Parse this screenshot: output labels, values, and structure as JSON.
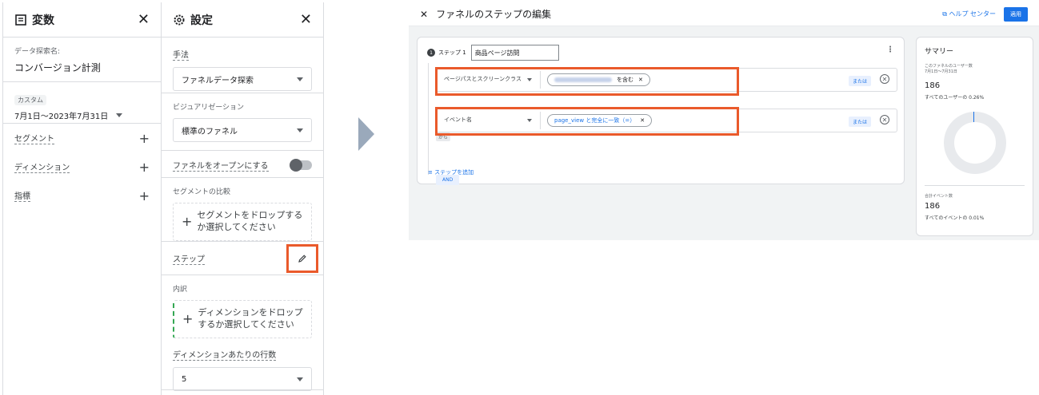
{
  "variables": {
    "title": "変数",
    "explore_name_label": "データ探索名:",
    "explore_name": "コンバージョン計測",
    "date_badge": "カスタム",
    "date_range": "7月1日～2023年7月31日",
    "rows": [
      "セグメント",
      "ディメンション",
      "指標"
    ]
  },
  "settings": {
    "title": "設定",
    "method_label": "手法",
    "method_value": "ファネルデータ探索",
    "viz_label": "ビジュアリゼーション",
    "viz_value": "標準のファネル",
    "open_funnel_label": "ファネルをオープンにする",
    "segment_compare_label": "セグメントの比較",
    "segment_drop": "セグメントをドロップするか選択してください",
    "steps_label": "ステップ",
    "breakdown_label": "内訳",
    "dimension_drop": "ディメンションをドロップするか選択してください",
    "rows_per_dim_label": "ディメンションあたりの行数",
    "rows_per_dim_value": "5"
  },
  "editor": {
    "title": "ファネルのステップの編集",
    "help": "ヘルプ センター",
    "apply": "適用",
    "step_number": "1",
    "step_label": "ステップ 1",
    "step_name": "商品ページ訪問",
    "cond1_field": "ページパスとスクリーンクラス",
    "cond1_value_suffix": "を含む",
    "cond2_field": "イベント名",
    "cond2_value": "page_view と完全に一致（=）",
    "or_label": "または",
    "kara_label": "から",
    "and_label": "AND",
    "add_step": "ステップを追加"
  },
  "summary": {
    "title": "サマリー",
    "users_label": "このファネルのユーザー数",
    "users_date": "7月1日～7月31日",
    "users_value": "186",
    "users_pct": "すべてのユーザーの 0.26%",
    "events_label": "合計イベント数",
    "events_value": "186",
    "events_pct": "すべてのイベントの 0.01%"
  },
  "colors": {
    "accent": "#1a73e8",
    "highlight": "#ea5a2b"
  }
}
